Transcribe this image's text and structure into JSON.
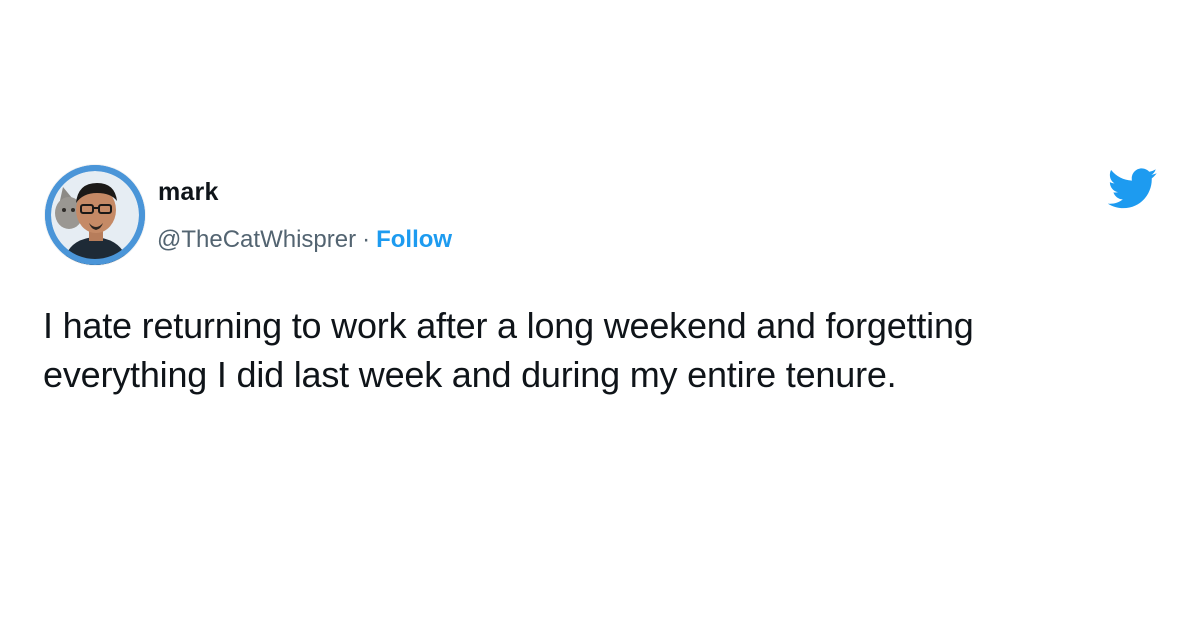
{
  "author": {
    "display_name": "mark",
    "handle": "@TheCatWhisprer",
    "separator": "·",
    "follow_label": "Follow",
    "avatar_icon": "profile-photo-icon"
  },
  "brand": {
    "logo_icon": "twitter-bird-icon",
    "accent_color": "#1d9bf0"
  },
  "tweet": {
    "lines": [
      "I hate returning to work after a long weekend and forgetting",
      "everything I did last week and during my entire tenure."
    ]
  }
}
